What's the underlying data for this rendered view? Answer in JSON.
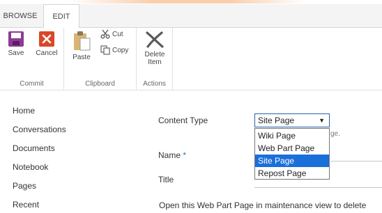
{
  "tabs": {
    "browse": "BROWSE",
    "edit": "EDIT"
  },
  "ribbon": {
    "commit": {
      "label": "Commit",
      "save": "Save",
      "cancel": "Cancel"
    },
    "clipboard": {
      "label": "Clipboard",
      "paste": "Paste",
      "cut": "Cut",
      "copy": "Copy"
    },
    "actions": {
      "label": "Actions",
      "delete_line1": "Delete",
      "delete_line2": "Item"
    }
  },
  "nav": [
    "Home",
    "Conversations",
    "Documents",
    "Notebook",
    "Pages",
    "Recent"
  ],
  "form": {
    "content_type_label": "Content Type",
    "content_type_value": "Site Page",
    "content_type_options": [
      "Wiki Page",
      "Web Part Page",
      "Site Page",
      "Repost Page"
    ],
    "selected_option": "Site Page",
    "hint_fragment": "ge.",
    "name_label": "Name",
    "required_marker": "*",
    "title_label": "Title",
    "info_text": "Open this Web Part Page in maintenance view to delete"
  },
  "colors": {
    "accent": "#1a6fd9",
    "save_icon": "#8a3d91",
    "cancel_icon": "#d9472b"
  }
}
